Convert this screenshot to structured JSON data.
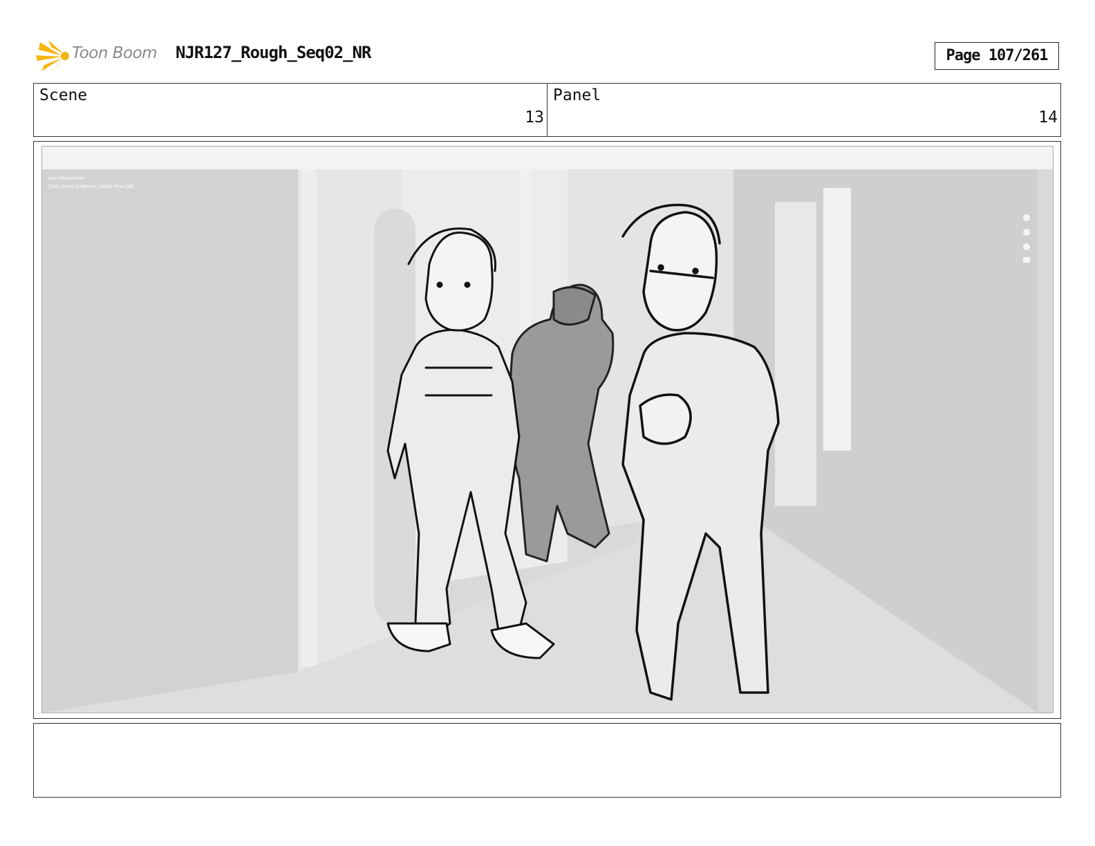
{
  "header": {
    "logo_text": "Toon Boom",
    "document_title": "NJR127_Rough_Seq02_NR",
    "page_label": "Page 107/261"
  },
  "info": {
    "scene_label": "Scene",
    "scene_value": "13",
    "panel_label": "Panel",
    "panel_value": "14"
  },
  "viewport": {
    "overlay_line1": "User Perspective",
    "overlay_line2": "(158) Scene Collection | Mitch Pose.008"
  },
  "caption": ""
}
